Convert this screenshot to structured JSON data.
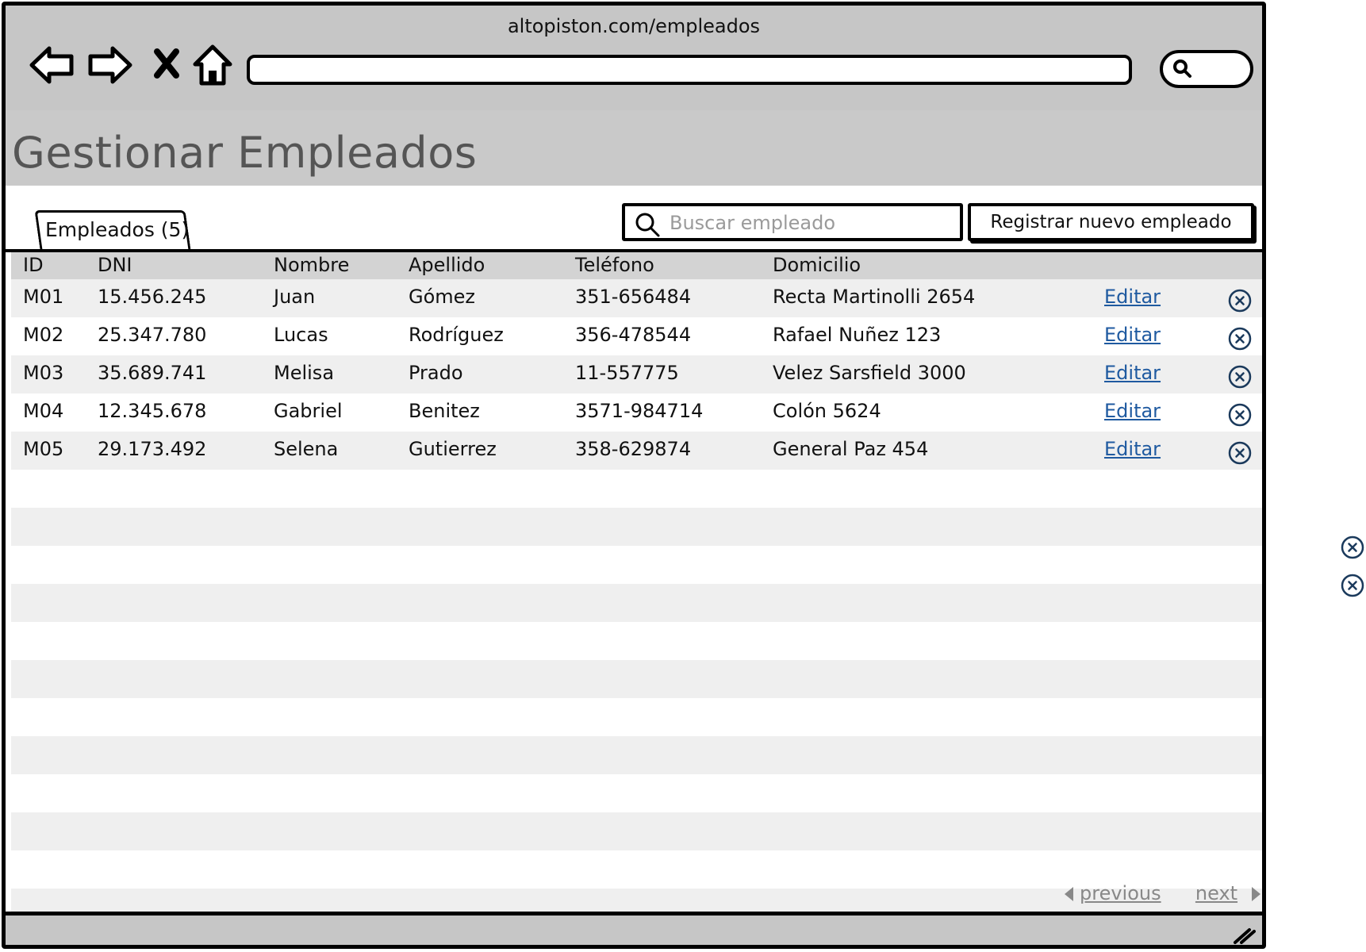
{
  "browser": {
    "url": "altopiston.com/empleados",
    "icons": [
      "back-arrow-icon",
      "forward-arrow-icon",
      "close-icon",
      "home-icon",
      "search-icon"
    ]
  },
  "page": {
    "title": "Gestionar Empleados"
  },
  "toolbar": {
    "tab_label": "Empleados (5)",
    "search_placeholder": "Buscar empleado",
    "new_button_label": "Registrar nuevo empleado"
  },
  "table": {
    "columns": [
      "ID",
      "DNI",
      "Nombre",
      "Apellido",
      "Teléfono",
      "Domicilio"
    ],
    "edit_label": "Editar",
    "rows": [
      {
        "id": "M01",
        "dni": "15.456.245",
        "nombre": "Juan",
        "apellido": "Gómez",
        "telefono": "351-656484",
        "domicilio": "Recta Martinolli 2654"
      },
      {
        "id": "M02",
        "dni": "25.347.780",
        "nombre": "Lucas",
        "apellido": "Rodríguez",
        "telefono": "356-478544",
        "domicilio": "Rafael Nuñez 123"
      },
      {
        "id": "M03",
        "dni": "35.689.741",
        "nombre": "Melisa",
        "apellido": "Prado",
        "telefono": "11-557775",
        "domicilio": "Velez Sarsfield 3000"
      },
      {
        "id": "M04",
        "dni": "12.345.678",
        "nombre": "Gabriel",
        "apellido": "Benitez",
        "telefono": "3571-984714",
        "domicilio": "Colón 5624"
      },
      {
        "id": "M05",
        "dni": "29.173.492",
        "nombre": "Selena",
        "apellido": "Gutierrez",
        "telefono": "358-629874",
        "domicilio": "General Paz 454"
      }
    ]
  },
  "pager": {
    "previous": "previous",
    "next": "next"
  },
  "colors": {
    "link": "#1f5aa0",
    "chrome": "#c6c6c6",
    "header_band": "#c9c9c9",
    "stripe": "#efefef"
  }
}
